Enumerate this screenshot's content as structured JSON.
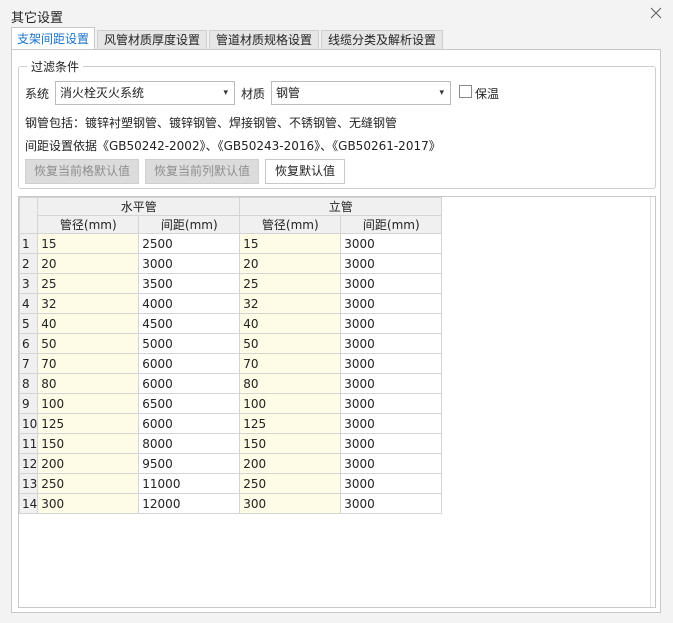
{
  "window": {
    "title": "其它设置"
  },
  "tabs": [
    {
      "label": "支架间距设置",
      "active": true
    },
    {
      "label": "风管材质厚度设置",
      "active": false
    },
    {
      "label": "管道材质规格设置",
      "active": false
    },
    {
      "label": "线缆分类及解析设置",
      "active": false
    }
  ],
  "filter": {
    "title": "过滤条件",
    "system_label": "系统",
    "system_value": "消火栓灭火系统",
    "material_label": "材质",
    "material_value": "钢管",
    "insulation_label": "保温",
    "insulation_checked": false,
    "includes_text": "钢管包括：镀锌衬塑钢管、镀锌钢管、焊接钢管、不锈钢管、无缝钢管",
    "basis_text": "间距设置依据《GB50242-2002》、《GB50243-2016》、《GB50261-2017》",
    "btn_restore_cell": "恢复当前格默认值",
    "btn_restore_column": "恢复当前列默认值",
    "btn_restore_default": "恢复默认值"
  },
  "table": {
    "group_horizontal": "水平管",
    "group_vertical": "立管",
    "col_diameter": "管径(mm)",
    "col_spacing": "间距(mm)",
    "rows": [
      {
        "n": "1",
        "h_d": "15",
        "h_s": "2500",
        "v_d": "15",
        "v_s": "3000"
      },
      {
        "n": "2",
        "h_d": "20",
        "h_s": "3000",
        "v_d": "20",
        "v_s": "3000"
      },
      {
        "n": "3",
        "h_d": "25",
        "h_s": "3500",
        "v_d": "25",
        "v_s": "3000"
      },
      {
        "n": "4",
        "h_d": "32",
        "h_s": "4000",
        "v_d": "32",
        "v_s": "3000"
      },
      {
        "n": "5",
        "h_d": "40",
        "h_s": "4500",
        "v_d": "40",
        "v_s": "3000"
      },
      {
        "n": "6",
        "h_d": "50",
        "h_s": "5000",
        "v_d": "50",
        "v_s": "3000"
      },
      {
        "n": "7",
        "h_d": "70",
        "h_s": "6000",
        "v_d": "70",
        "v_s": "3000"
      },
      {
        "n": "8",
        "h_d": "80",
        "h_s": "6000",
        "v_d": "80",
        "v_s": "3000"
      },
      {
        "n": "9",
        "h_d": "100",
        "h_s": "6500",
        "v_d": "100",
        "v_s": "3000"
      },
      {
        "n": "10",
        "h_d": "125",
        "h_s": "6000",
        "v_d": "125",
        "v_s": "3000"
      },
      {
        "n": "11",
        "h_d": "150",
        "h_s": "8000",
        "v_d": "150",
        "v_s": "3000"
      },
      {
        "n": "12",
        "h_d": "200",
        "h_s": "9500",
        "v_d": "200",
        "v_s": "3000"
      },
      {
        "n": "13",
        "h_d": "250",
        "h_s": "11000",
        "v_d": "250",
        "v_s": "3000"
      },
      {
        "n": "14",
        "h_d": "300",
        "h_s": "12000",
        "v_d": "300",
        "v_s": "3000"
      }
    ]
  },
  "colors": {
    "accent": "#1a73c8",
    "diameter_cell_bg": "#fefbe6",
    "header_bg": "#f0f0f0"
  },
  "icons": {
    "close": "close-icon",
    "dropdown": "chevron-down-icon",
    "checkbox": "checkbox-icon"
  }
}
